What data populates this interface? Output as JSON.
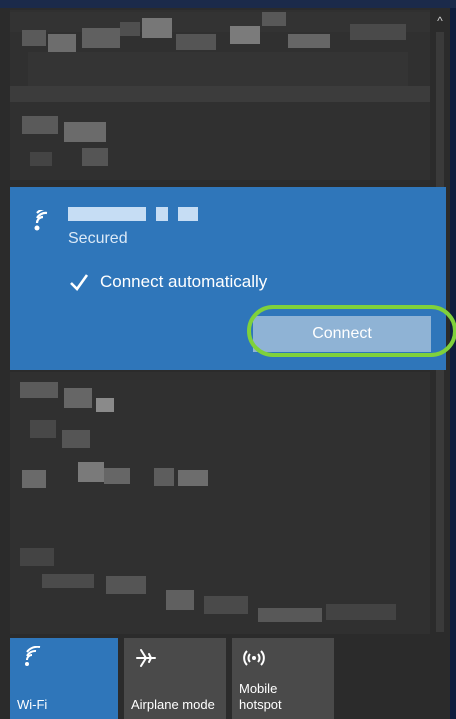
{
  "network": {
    "status": "Secured",
    "auto_connect_label": "Connect automatically",
    "auto_connect_checked": true,
    "connect_label": "Connect"
  },
  "quick_actions": {
    "wifi_label": "Wi-Fi",
    "airplane_label": "Airplane mode",
    "hotspot_label_line1": "Mobile",
    "hotspot_label_line2": "hotspot"
  },
  "icons": {
    "scroll_up": "^"
  },
  "colors": {
    "panel_bg": "#2b2b2b",
    "accent": "#2f76ba",
    "highlight_ring": "#7fd13b",
    "connect_button": "#8fb3d5"
  }
}
